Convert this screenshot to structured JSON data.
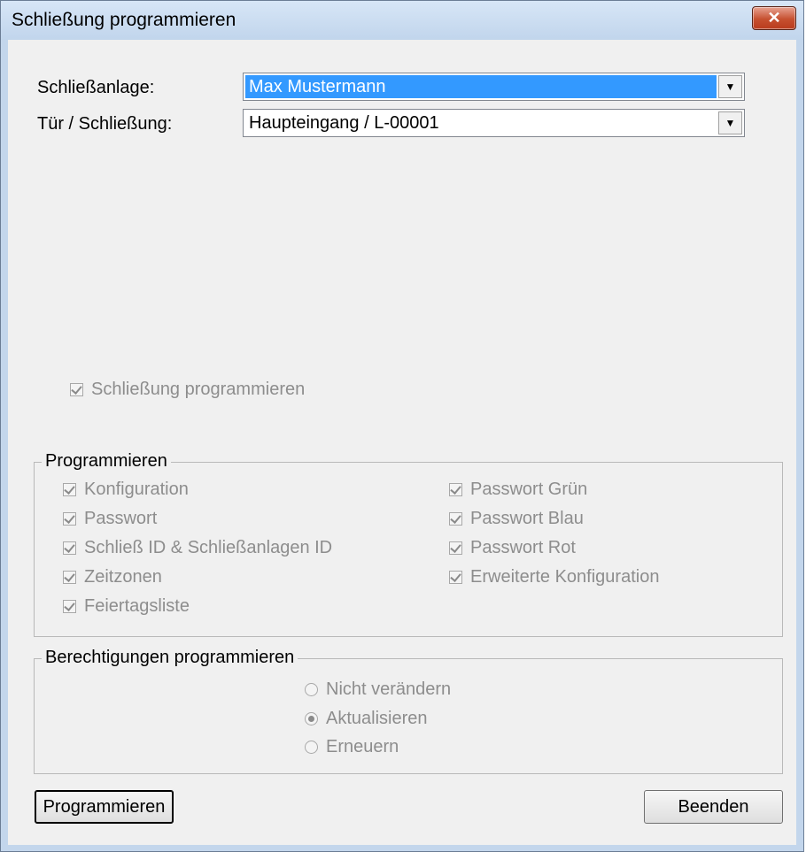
{
  "window": {
    "title": "Schließung programmieren"
  },
  "form": {
    "anlage_label": "Schließanlage:",
    "anlage_value": "Max Mustermann",
    "tuer_label": "Tür / Schließung:",
    "tuer_value": "Haupteingang / L-00001"
  },
  "main_checkbox": {
    "label": "Schließung programmieren",
    "checked": true,
    "enabled": false
  },
  "programmieren": {
    "legend": "Programmieren",
    "left": [
      "Konfiguration",
      "Passwort",
      "Schließ ID & Schließanlagen ID",
      "Zeitzonen",
      "Feiertagsliste"
    ],
    "right": [
      "Passwort Grün",
      "Passwort Blau",
      "Passwort Rot",
      "Erweiterte Konfiguration"
    ]
  },
  "berechtigungen": {
    "legend": "Berechtigungen programmieren",
    "options": [
      "Nicht verändern",
      "Aktualisieren",
      "Erneuern"
    ],
    "selected": "Aktualisieren"
  },
  "buttons": {
    "program": "Programmieren",
    "close": "Beenden"
  },
  "icons": {
    "close": "close-icon",
    "dropdown": "chevron-down-icon"
  }
}
